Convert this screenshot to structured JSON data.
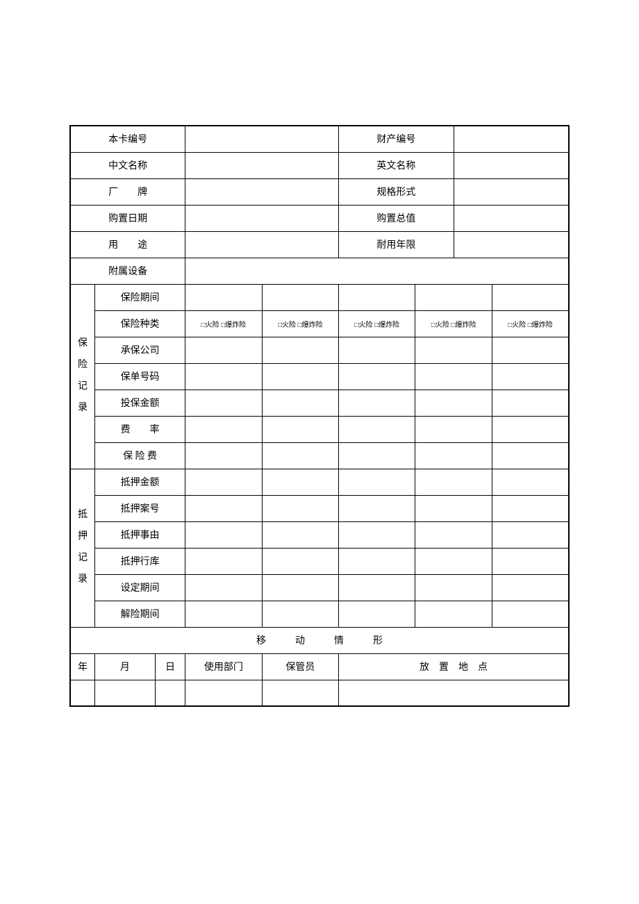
{
  "labels": {
    "card_no": "本卡编号",
    "asset_no": "财产编号",
    "name_cn": "中文名称",
    "name_en": "英文名称",
    "brand": "厂　　牌",
    "spec": "规格形式",
    "buy_date": "购置日期",
    "buy_total": "购置总值",
    "usage": "用　　途",
    "durable": "耐用年限",
    "accessory": "附属设备",
    "ins_group": "保险记录",
    "ins_period": "保险期间",
    "ins_type": "保险种类",
    "ins_company": "承保公司",
    "ins_policy": "保单号码",
    "ins_amount": "投保金额",
    "ins_rate": "费　　率",
    "ins_fee": "保 险 费",
    "mort_group": "抵押记录",
    "mort_amount": "抵押金额",
    "mort_case": "抵押案号",
    "mort_reason": "抵押事由",
    "mort_bank": "抵押行库",
    "mort_set": "设定期间",
    "mort_release": "解险期间",
    "move_title": "移　　　动　　　情　　　形",
    "year": "年",
    "month": "月",
    "day": "日",
    "dept": "使用部门",
    "keeper": "保管员",
    "location": "放　置　地　点"
  },
  "ins_type_opt": "□火险 □爆炸险"
}
